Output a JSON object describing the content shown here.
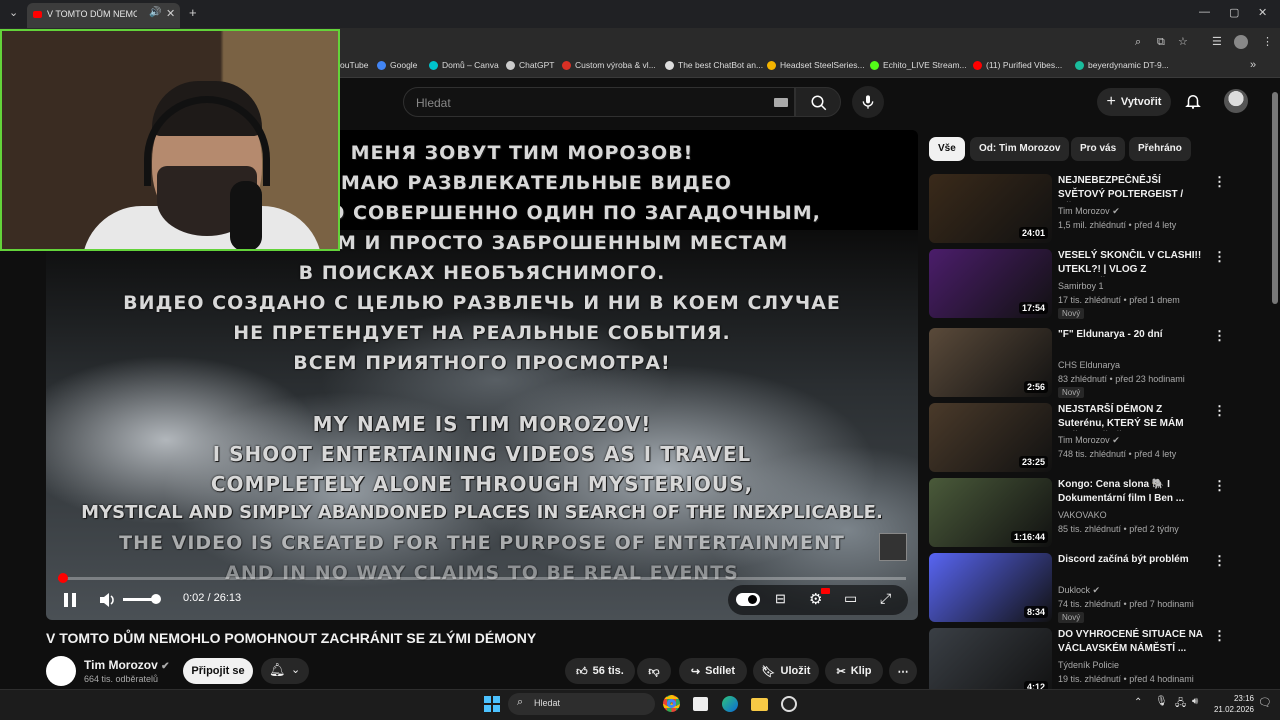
{
  "browser": {
    "tab_title": "V TOMTO DŮM NEMOHLO",
    "bookmarks": [
      {
        "label": "ouTube",
        "color": "#ff0000"
      },
      {
        "label": "Google",
        "color": "#4285f4"
      },
      {
        "label": "Domů – Canva",
        "color": "#00c4cc"
      },
      {
        "label": "ChatGPT",
        "color": "#cccccc"
      },
      {
        "label": "Custom výroba & vl...",
        "color": "#d93025"
      },
      {
        "label": "The best ChatBot an...",
        "color": "#dddddd"
      },
      {
        "label": "Headset SteelSeries...",
        "color": "#f4b400"
      },
      {
        "label": "Echito_LIVE Stream...",
        "color": "#53fc18"
      },
      {
        "label": "(11) Purified Vibes...",
        "color": "#ff0000"
      },
      {
        "label": "beyerdynamic DT-9...",
        "color": "#1abc9c"
      }
    ]
  },
  "header": {
    "search_placeholder": "Hledat",
    "create_label": "Vytvořit"
  },
  "player": {
    "overlay_text_ru": [
      "МЕНЯ ЗОВУТ ТИМ МОРОЗОВ!",
      "СНИМАЮ РАЗВЛЕКАТЕЛЬНЫЕ ВИДЕО",
      "ПУТЕШЕСТВУЮ СОВЕРШЕННО ОДИН ПО ЗАГАДОЧНЫМ,",
      "МИСТИЧЕСКИМ И ПРОСТО ЗАБРОШЕННЫМ МЕСТАМ",
      "В ПОИСКАХ НЕОБЪЯСНИМОГО.",
      "ВИДЕО СОЗДАНО С ЦЕЛЬЮ РАЗВЛЕЧЬ И НИ В КОЕМ СЛУЧАЕ",
      "НЕ ПРЕТЕНДУЕТ НА РЕАЛЬНЫЕ СОБЫТИЯ.",
      "ВСЕМ ПРИЯТНОГО ПРОСМОТРА!"
    ],
    "overlay_text_en": [
      "MY NAME IS TIM MOROZOV!",
      "I SHOOT ENTERTAINING VIDEOS AS I TRAVEL",
      "COMPLETELY ALONE THROUGH MYSTERIOUS,",
      "MYSTICAL AND SIMPLY ABANDONED PLACES IN SEARCH OF THE INEXPLICABLE.",
      "THE VIDEO IS CREATED FOR THE PURPOSE OF ENTERTAINMENT",
      "AND IN NO WAY CLAIMS TO BE REAL EVENTS"
    ],
    "time": "0:02 / 26:13",
    "progress_fraction": 0.0013,
    "volume_fraction": 0.85
  },
  "video": {
    "title": "V TOMTO DŮM NEMOHLO POMOHNOUT ZACHRÁNIT SE ZLÝMI DÉMONY",
    "channel": "Tim Morozov",
    "subscribers": "664 tis. odběratelů",
    "join_label": "Připojit se",
    "likes": "56 tis.",
    "share_label": "Sdílet",
    "save_label": "Uložit",
    "clip_label": "Klip"
  },
  "chips": [
    "Vše",
    "Od: Tim Morozov",
    "Pro vás",
    "Přehráno"
  ],
  "recommendations": [
    {
      "title": "NEJNEBEZPEČNĚJŠÍ SVĚTOVÝ POLTERGEIST / DĚSIVÉ ZLO s...",
      "channel": "Tim Morozov",
      "verified": true,
      "meta": "1,5 mil. zhlédnutí • před 4 lety",
      "duration": "24:01",
      "badge": "",
      "thumb_color": "#3a2a1a"
    },
    {
      "title": "VESELÝ SKONČIL V CLASHI!! UTEKL?! | VLOG Z GALAVEČER...",
      "channel": "Samirboy 1",
      "verified": false,
      "meta": "17 tis. zhlédnutí • před 1 dnem",
      "duration": "17:54",
      "badge": "Nový",
      "thumb_color": "#4b1d6b"
    },
    {
      "title": "\"F\" Eldunarya - 20 dní",
      "channel": "CHS Eldunarya",
      "verified": false,
      "meta": "83 zhlédnutí • před 23 hodinami",
      "duration": "2:56",
      "badge": "Nový",
      "thumb_color": "#5a4a3a"
    },
    {
      "title": "NEJSTARŠÍ DÉMON Z Suterénu, KTERÝ SE MÁM VEČER VĚDĚT",
      "channel": "Tim Morozov",
      "verified": true,
      "meta": "748 tis. zhlédnutí • před 4 lety",
      "duration": "23:25",
      "badge": "",
      "thumb_color": "#4a3a2a"
    },
    {
      "title": "Kongo: Cena slona 🐘 I Dokumentární film I Ben ...",
      "channel": "VAKOVAKO",
      "verified": false,
      "meta": "85 tis. zhlédnutí • před 2 týdny",
      "duration": "1:16:44",
      "badge": "",
      "thumb_color": "#4a5a3a"
    },
    {
      "title": "Discord začíná být problém",
      "channel": "Duklock",
      "verified": true,
      "meta": "74 tis. zhlédnutí • před 7 hodinami",
      "duration": "8:34",
      "badge": "Nový",
      "thumb_color": "#5865f2"
    },
    {
      "title": "DO VYHROCENÉ SITUACE NA VÁCLAVSKÉM NÁMĚSTÍ ...",
      "channel": "Týdeník Policie",
      "verified": false,
      "meta": "19 tis. zhlédnutí • před 4 hodinami",
      "duration": "4:12",
      "badge": "",
      "thumb_color": "#3a3f45"
    }
  ],
  "taskbar": {
    "search_placeholder": "Hledat",
    "time": "23:16",
    "date": "21.02.2026"
  }
}
